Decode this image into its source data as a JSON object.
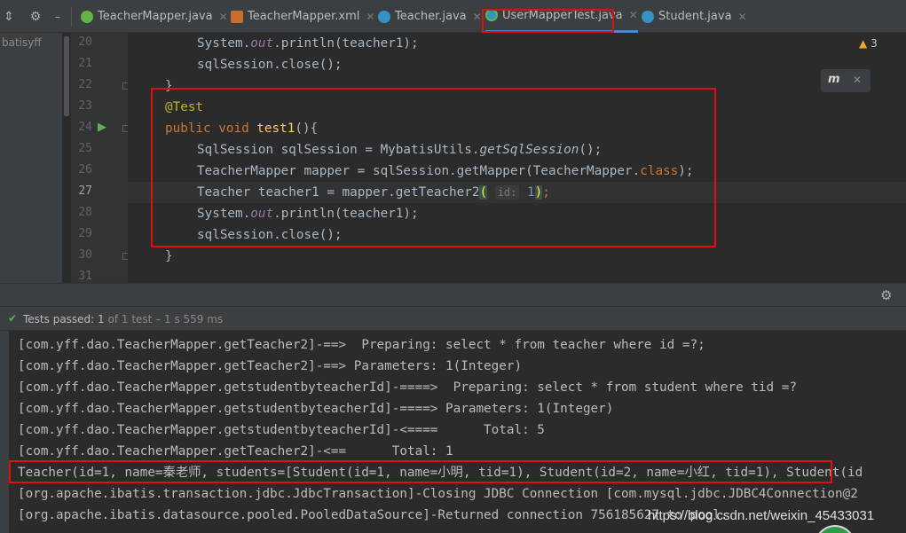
{
  "toolbar": {
    "collapse_icon": "collapse-all-icon",
    "settings_icon": "gear-icon"
  },
  "tabs": [
    {
      "label": "TeacherMapper.java",
      "icon": "interface-icon"
    },
    {
      "label": "TeacherMapper.xml",
      "icon": "xml-file-icon"
    },
    {
      "label": "Teacher.java",
      "icon": "class-icon"
    },
    {
      "label": "UserMapperTest.java",
      "icon": "test-class-icon",
      "active": true
    },
    {
      "label": "Student.java",
      "icon": "class-icon"
    }
  ],
  "project": {
    "label": "batisyff"
  },
  "editor": {
    "warnings": "3",
    "badge": "m",
    "line_numbers": [
      "20",
      "21",
      "22",
      "23",
      "24",
      "25",
      "26",
      "27",
      "28",
      "29",
      "30",
      "31"
    ],
    "lines": [
      "System.out.println(teacher1);",
      "sqlSession.close();",
      "}",
      "@Test",
      "public void test1(){",
      "SqlSession sqlSession = MybatisUtils.getSqlSession();",
      "TeacherMapper mapper = sqlSession.getMapper(TeacherMapper.class);",
      "Teacher teacher1 = mapper.getTeacher2( id: 1);",
      "System.out.println(teacher1);",
      "sqlSession.close();",
      "}"
    ],
    "tokens": {
      "l20_a": "System.",
      "l20_b": "out",
      "l20_c": ".println(teacher1);",
      "l21": "sqlSession.close();",
      "l22": "}",
      "l23": "@Test",
      "l24_kw": "public void ",
      "l24_fn": "test1",
      "l24_end": "(){",
      "l25_a": "SqlSession sqlSession = MybatisUtils.",
      "l25_b": "getSqlSession",
      "l25_c": "();",
      "l26_a": "TeacherMapper mapper = sqlSession.getMapper(TeacherMapper.",
      "l26_b": "class",
      "l26_c": ");",
      "l27_a": "Teacher teacher1 = mapper.getTeacher2",
      "l27_open": "(",
      "l27_hint": "id:",
      "l27_num": "1",
      "l27_close": ")",
      "l27_end": ";",
      "l28_a": "System.",
      "l28_b": "out",
      "l28_c": ".println(teacher1);",
      "l29": "sqlSession.close();",
      "l30": "}"
    }
  },
  "run": {
    "status_prefix": "Tests passed: ",
    "status_count": "1",
    "status_rest": " of 1 test – 1 s 559 ms",
    "console": [
      "[com.yff.dao.TeacherMapper.getTeacher2]-==>  Preparing: select * from teacher where id =?;",
      "[com.yff.dao.TeacherMapper.getTeacher2]-==> Parameters: 1(Integer)",
      "[com.yff.dao.TeacherMapper.getstudentbyteacherId]-====>  Preparing: select * from student where tid =?",
      "[com.yff.dao.TeacherMapper.getstudentbyteacherId]-====> Parameters: 1(Integer)",
      "[com.yff.dao.TeacherMapper.getstudentbyteacherId]-<====      Total: 5",
      "[com.yff.dao.TeacherMapper.getTeacher2]-<==      Total: 1",
      "Teacher(id=1, name=秦老师, students=[Student(id=1, name=小明, tid=1), Student(id=2, name=小红, tid=1), Student(id",
      "[org.apache.ibatis.transaction.jdbc.JdbcTransaction]-Closing JDBC Connection [com.mysql.jdbc.JDBC4Connection@2",
      "[org.apache.ibatis.datasource.pooled.PooledDataSource]-Returned connection 756185627 to pool."
    ],
    "watermark": "https://blog.csdn.net/weixin_45433031"
  },
  "colors": {
    "highlight_box": "#e01010",
    "keyword": "#cc7832",
    "annotation": "#bbb529",
    "method": "#ffc66d",
    "passed": "#5fb152"
  }
}
